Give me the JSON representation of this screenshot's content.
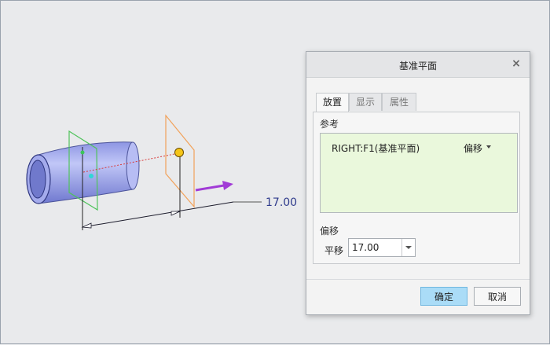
{
  "viewport": {
    "dimension_value": "17.00"
  },
  "dialog": {
    "title": "基准平面",
    "close_glyph": "×",
    "tabs": [
      {
        "label": "放置",
        "active": true
      },
      {
        "label": "显示",
        "active": false
      },
      {
        "label": "属性",
        "active": false
      }
    ],
    "references": {
      "label": "参考",
      "items": [
        {
          "name": "RIGHT:F1(基准平面)",
          "constraint": "偏移"
        }
      ]
    },
    "offset": {
      "section_label": "偏移",
      "field_label": "平移",
      "value": "17.00"
    },
    "buttons": {
      "ok": "确定",
      "cancel": "取消"
    }
  },
  "colors": {
    "ok_button": "#aadcf7",
    "reference_collector": "#eaf8dc",
    "cylinder": "#a6aef0",
    "datum_plane_new": "#f2a25a",
    "datum_plane_ref": "#4fc35b",
    "drag_arrow": "#a13bd6"
  }
}
